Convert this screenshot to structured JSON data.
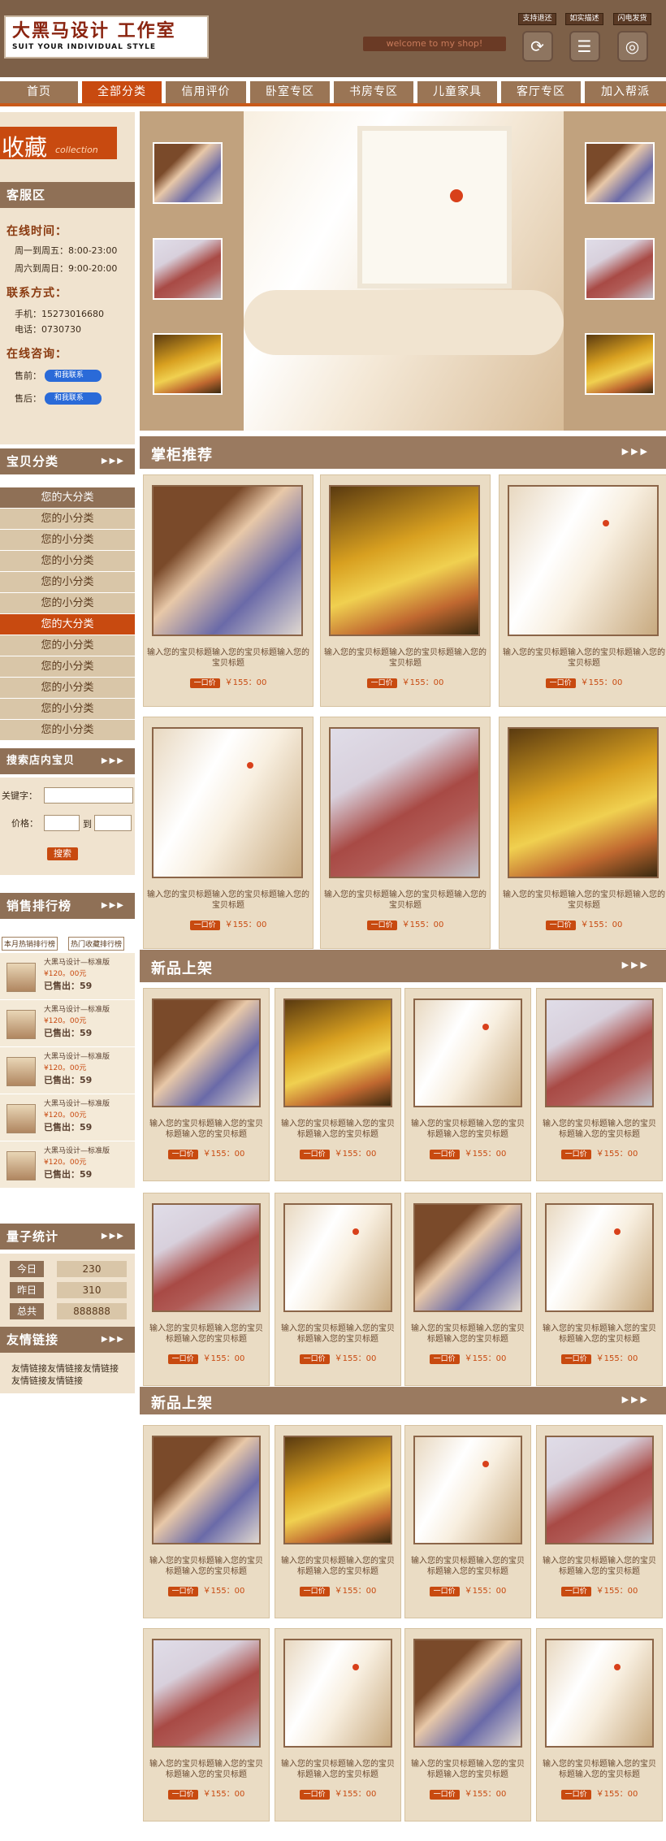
{
  "header": {
    "logo_title": "大黑马设计 工作室",
    "logo_subtitle": "SUIT YOUR INDIVIDUAL STYLE",
    "welcome": "welcome to my shop!",
    "quick_buttons": [
      {
        "label": "支持退还",
        "icon": "refresh-icon"
      },
      {
        "label": "如实描述",
        "icon": "document-icon"
      },
      {
        "label": "闪电发货",
        "icon": "delivery-icon"
      }
    ]
  },
  "nav": [
    "首页",
    "全部分类",
    "信用评价",
    "卧室专区",
    "书房专区",
    "儿童家具",
    "客厅专区",
    "加入帮派"
  ],
  "favorites": {
    "label": "收藏",
    "sub": "collection"
  },
  "service": {
    "title": "客服区",
    "online_label": "在线时间：",
    "hours": [
      "周一到周五：8:00-23:00",
      "周六到周日：9:00-20:00"
    ],
    "contact_label": "联系方式：",
    "phone": "手机：15273016680",
    "tel": "电话：0730730",
    "consult_label": "在线咨询：",
    "consult": [
      {
        "label": "售前：",
        "btn": "和我联系"
      },
      {
        "label": "售后：",
        "btn": "和我联系"
      }
    ]
  },
  "categories": {
    "title": "宝贝分类",
    "items": [
      {
        "label": "您的大分类",
        "big": true,
        "active": false
      },
      {
        "label": "您的小分类"
      },
      {
        "label": "您的小分类"
      },
      {
        "label": "您的小分类"
      },
      {
        "label": "您的小分类"
      },
      {
        "label": "您的小分类"
      },
      {
        "label": "您的大分类",
        "big": true,
        "active": true
      },
      {
        "label": "您的小分类"
      },
      {
        "label": "您的小分类"
      },
      {
        "label": "您的小分类"
      },
      {
        "label": "您的小分类"
      },
      {
        "label": "您的小分类"
      }
    ]
  },
  "search": {
    "title": "搜索店内宝贝",
    "keyword": "关键字：",
    "price": "价格：",
    "to": "到",
    "button": "搜索"
  },
  "ranking": {
    "title": "销售排行榜",
    "tabs": [
      "本月热销排行榜",
      "热门收藏排行榜"
    ],
    "items": [
      {
        "name": "大黑马设计—标准版",
        "price": "¥120。00元",
        "sold": "已售出：59"
      },
      {
        "name": "大黑马设计—标准版",
        "price": "¥120。00元",
        "sold": "已售出：59"
      },
      {
        "name": "大黑马设计—标准版",
        "price": "¥120。00元",
        "sold": "已售出：59"
      },
      {
        "name": "大黑马设计—标准版",
        "price": "¥120。00元",
        "sold": "已售出：59"
      },
      {
        "name": "大黑马设计—标准版",
        "price": "¥120。00元",
        "sold": "已售出：59"
      }
    ]
  },
  "stats": {
    "title": "量子统计",
    "rows": [
      {
        "label": "今日",
        "value": "230"
      },
      {
        "label": "昨日",
        "value": "310"
      },
      {
        "label": "总共",
        "value": "888888"
      }
    ]
  },
  "links": {
    "title": "友情链接",
    "text": "友情链接友情链接友情链接友情链接友情链接"
  },
  "sections": [
    {
      "title": "掌柜推荐"
    },
    {
      "title": "新品上架"
    },
    {
      "title": "新品上架"
    }
  ],
  "product": {
    "caption": "输入您的宝贝标题输入您的宝贝标题输入您的宝贝标题",
    "price_label": "一口价",
    "price": "￥155：00"
  }
}
